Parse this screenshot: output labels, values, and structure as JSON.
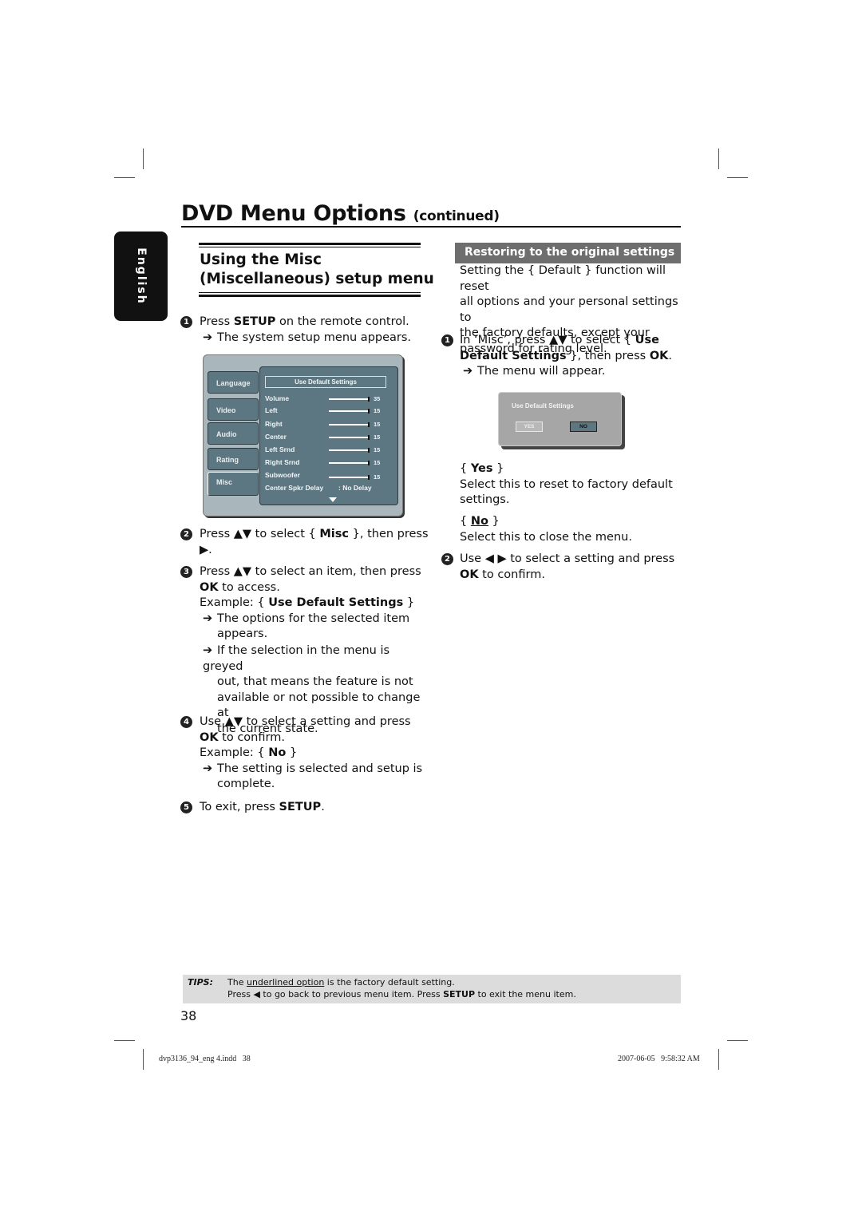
{
  "page": {
    "title": "DVD Menu Options",
    "title_suffix": "(continued)",
    "language_tab": "English",
    "page_number": "38"
  },
  "left": {
    "section_title_line1": "Using the Misc",
    "section_title_line2": "(Miscellaneous) setup menu",
    "step1": {
      "num": "1",
      "pre": "Press ",
      "bold": "SETUP",
      "post": " on the remote control.",
      "result": "The system setup menu appears."
    },
    "setup_menu": {
      "tabs": [
        "Language",
        "Video",
        "Audio",
        "Rating",
        "Misc"
      ],
      "selected_tab": "Misc",
      "header": "Use Default Settings",
      "rows": [
        {
          "label": "Volume",
          "value": "35"
        },
        {
          "label": "Left",
          "value": "15"
        },
        {
          "label": "Right",
          "value": "15"
        },
        {
          "label": "Center",
          "value": "15"
        },
        {
          "label": "Left Srnd",
          "value": "15"
        },
        {
          "label": "Right Srnd",
          "value": "15"
        },
        {
          "label": "Subwoofer",
          "value": "15"
        }
      ],
      "delay_label": "Center Spkr Delay",
      "delay_value": ": No Delay"
    },
    "step2": {
      "num": "2",
      "pre": "Press ▲▼ to select { ",
      "bold": "Misc",
      "post": " }, then press",
      "line2": "▶."
    },
    "step3": {
      "num": "3",
      "pre": "Press ▲▼ to select an item, then press",
      "bold": "OK",
      "post": " to access.",
      "example_pre": "Example: { ",
      "example_bold": "Use Default Settings",
      "example_post": " }",
      "result1a": "The options for the selected item",
      "result1b": "appears.",
      "result2a": "If the selection in the menu is greyed",
      "result2b": "out, that means the feature is not",
      "result2c": "available or not possible to change at",
      "result2d": "the current state."
    },
    "step4": {
      "num": "4",
      "pre": "Use ▲▼ to select a setting and press",
      "bold": "OK",
      "post": " to confirm.",
      "example_pre": "Example: { ",
      "example_bold": "No",
      "example_post": " }",
      "result_a": "The setting is selected and setup is",
      "result_b": "complete."
    },
    "step5": {
      "num": "5",
      "pre": "To exit, press ",
      "bold": "SETUP",
      "post": "."
    }
  },
  "right": {
    "heading": "Restoring to the original settings",
    "intro": [
      "Setting the { Default } function will reset",
      "all options and your personal settings to",
      "the factory defaults, except your",
      "password for rating level."
    ],
    "step1": {
      "num": "1",
      "pre": "In ‘Misc’, press ▲▼ to select { ",
      "bold1": "Use",
      "bold2": "Default Settings",
      "mid": " }, then press ",
      "bold3": "OK",
      "post": ".",
      "result": "The menu will appear."
    },
    "dialog": {
      "title": "Use Default Settings",
      "yes": "YES",
      "no": "NO",
      "selected": "NO"
    },
    "yes_label": "Yes",
    "yes_desc": [
      "Select this to reset to factory default",
      "settings."
    ],
    "no_label": "No",
    "no_desc": "Select this to close the menu.",
    "step2": {
      "num": "2",
      "pre": "Use ◀ ▶ to select a setting and press",
      "bold": "OK",
      "post": " to confirm."
    }
  },
  "tips": {
    "label": "TIPS:",
    "line1_pre": "The ",
    "line1_u": "underlined option",
    "line1_post": " is the factory default setting.",
    "line2_pre": "Press ◀ to go back to previous menu item. Press ",
    "line2_bold": "SETUP",
    "line2_post": " to exit the menu item."
  },
  "footer": {
    "file": "dvp3136_94_eng 4.indd   38",
    "timestamp": "2007-06-05   9:58:32 AM"
  }
}
